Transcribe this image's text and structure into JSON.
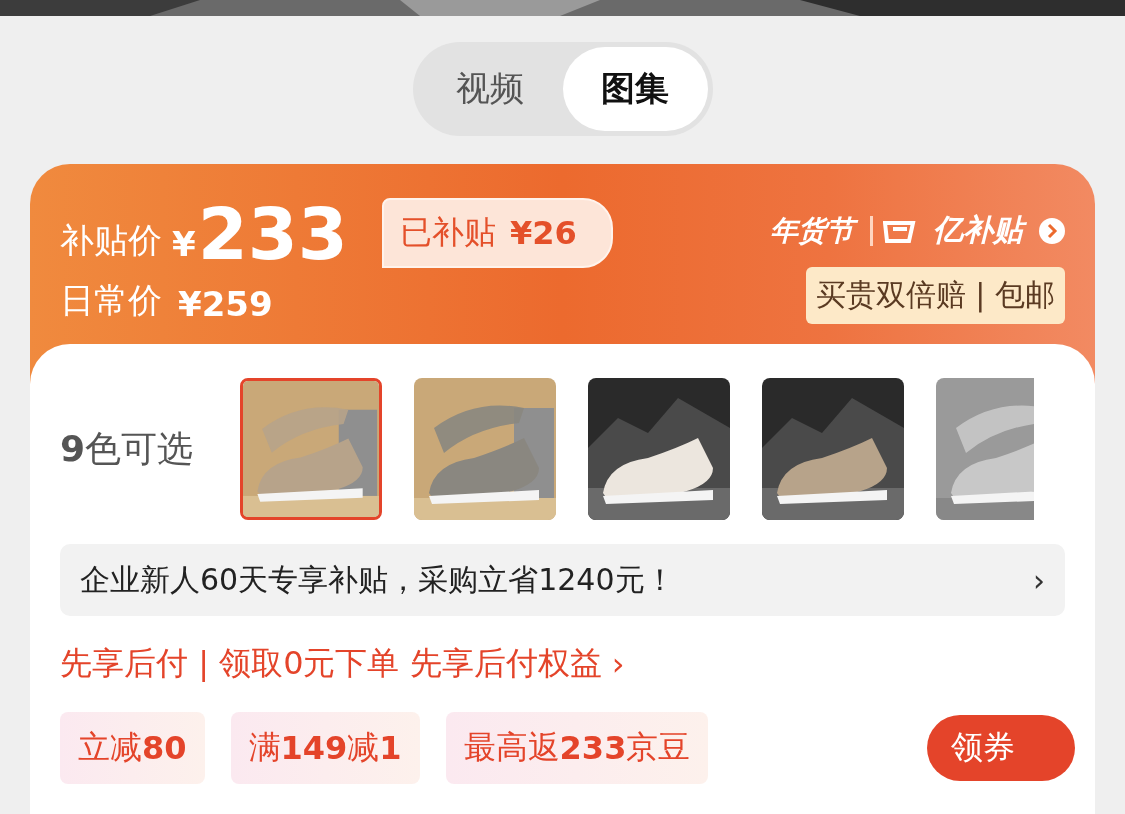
{
  "tabs": [
    {
      "label": "视频",
      "selected": false
    },
    {
      "label": "图集",
      "selected": true
    }
  ],
  "price": {
    "subsidy_label": "补贴价",
    "currency": "¥",
    "subsidy_price": "233",
    "subsidized_label": "已补贴",
    "subsidized_amount": "¥26",
    "regular_label": "日常价",
    "regular_price": "¥259"
  },
  "promo": {
    "festival": "年货节",
    "program": "亿补贴",
    "guarantee": "买贵双倍赔 | 包邮"
  },
  "colors": {
    "label": "**9**色可选",
    "options": [
      {
        "selected": true
      },
      {
        "selected": false
      },
      {
        "selected": false
      },
      {
        "selected": false
      },
      {
        "selected": false
      }
    ]
  },
  "banner": {
    "text": "企业新人60天专享补贴，采购立省1240元！",
    "arrow": "›"
  },
  "pay_later": {
    "text": "先享后付 | 领取0元下单 先享后付权益",
    "arrow": "›"
  },
  "coupons": [
    "立减**80**",
    "满**149**减**1**",
    "最高返**233**京豆"
  ],
  "claim_button": "领券"
}
